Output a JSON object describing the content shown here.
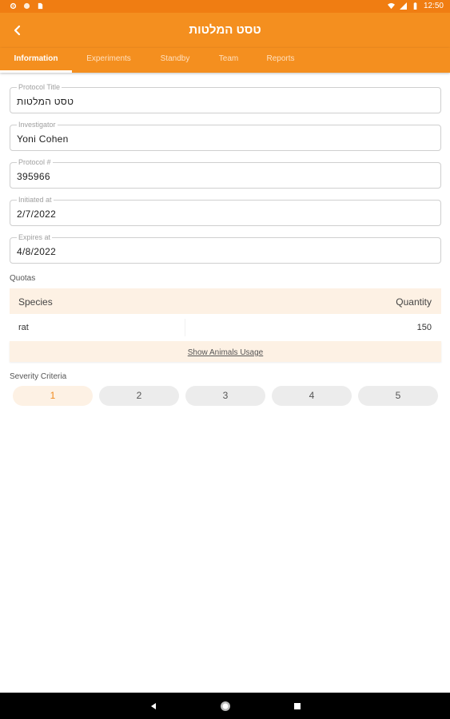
{
  "status_bar": {
    "time": "12:50",
    "left_icons": [
      "gear-icon",
      "circle-icon",
      "sim-icon"
    ],
    "right_icons": [
      "wifi-icon",
      "signal-icon",
      "battery-icon"
    ]
  },
  "app_bar": {
    "title": "טסט המלטות",
    "back_icon": "chevron-left-icon"
  },
  "tabs": [
    {
      "label": "Information",
      "active": true
    },
    {
      "label": "Experiments",
      "active": false
    },
    {
      "label": "Standby",
      "active": false
    },
    {
      "label": "Team",
      "active": false
    },
    {
      "label": "Reports",
      "active": false
    }
  ],
  "fields": {
    "protocol_title": {
      "label": "Protocol Title",
      "value": "טסט המלטות"
    },
    "investigator": {
      "label": "Investigator",
      "value": "Yoni Cohen"
    },
    "protocol_number": {
      "label": "Protocol #",
      "value": "395966"
    },
    "initiated_at": {
      "label": "Initiated at",
      "value": "2/7/2022"
    },
    "expires_at": {
      "label": "Expires at",
      "value": "4/8/2022"
    }
  },
  "quotas": {
    "section_label": "Quotas",
    "columns": [
      "Species",
      "Quantity"
    ],
    "rows": [
      {
        "species": "rat",
        "quantity": "150"
      }
    ],
    "footer_link": "Show Animals Usage"
  },
  "severity": {
    "section_label": "Severity Criteria",
    "options": [
      "1",
      "2",
      "3",
      "4",
      "5"
    ],
    "selected": "1"
  },
  "colors": {
    "accent": "#f48f1f",
    "status_bar": "#f07d12",
    "highlight_bg": "#fdf1e4"
  },
  "nav_bar": {
    "icons": [
      "back-triangle-icon",
      "home-circle-icon",
      "recents-square-icon"
    ]
  }
}
